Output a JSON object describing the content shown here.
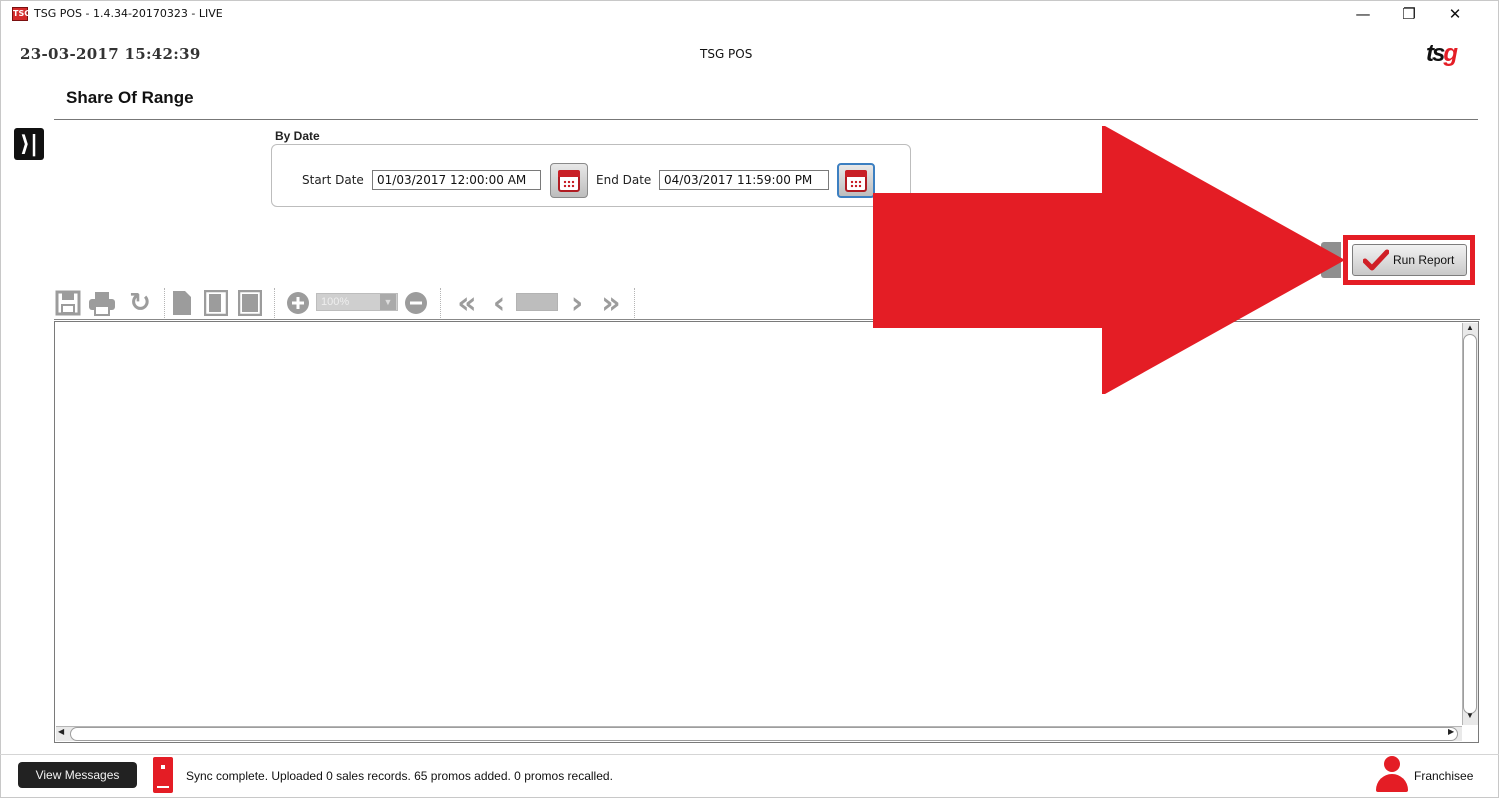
{
  "window": {
    "title": "TSG POS - 1.4.34-20170323 - LIVE",
    "icon_text": "TSG",
    "controls": {
      "minimize": "—",
      "restore": "❐",
      "close": "✕"
    }
  },
  "header": {
    "datetime": "23-03-2017 15:42:39",
    "center_title": "TSG POS",
    "logo_main": "ts",
    "logo_accent": "g"
  },
  "page": {
    "title": "Share Of Range",
    "sidebar_toggle_glyph": "⟩|"
  },
  "filters": {
    "group_label": "By Date",
    "start_label": "Start Date",
    "start_value": "01/03/2017 12:00:00 AM",
    "end_label": "End Date",
    "end_value": "04/03/2017 11:59:00 PM"
  },
  "toolbar": {
    "zoom_value": "100%",
    "icons": [
      "save-icon",
      "print-icon",
      "refresh-icon",
      "page-icon",
      "page-icon",
      "page-icon",
      "zoom-in-icon",
      "zoom-out-icon",
      "first-page-icon",
      "prev-page-icon",
      "next-page-icon",
      "last-page-icon"
    ]
  },
  "actions": {
    "run_report_label": "Run Report"
  },
  "annotation": {
    "arrow_color": "#e41d25",
    "highlight_color": "#e41d25"
  },
  "status": {
    "view_messages_label": "View Messages",
    "sync_text": "Sync complete.  Uploaded 0 sales records. 65 promos added. 0 promos recalled.",
    "user_role": "Franchisee"
  },
  "colors": {
    "brand_red": "#e41d25",
    "dark": "#222222"
  }
}
